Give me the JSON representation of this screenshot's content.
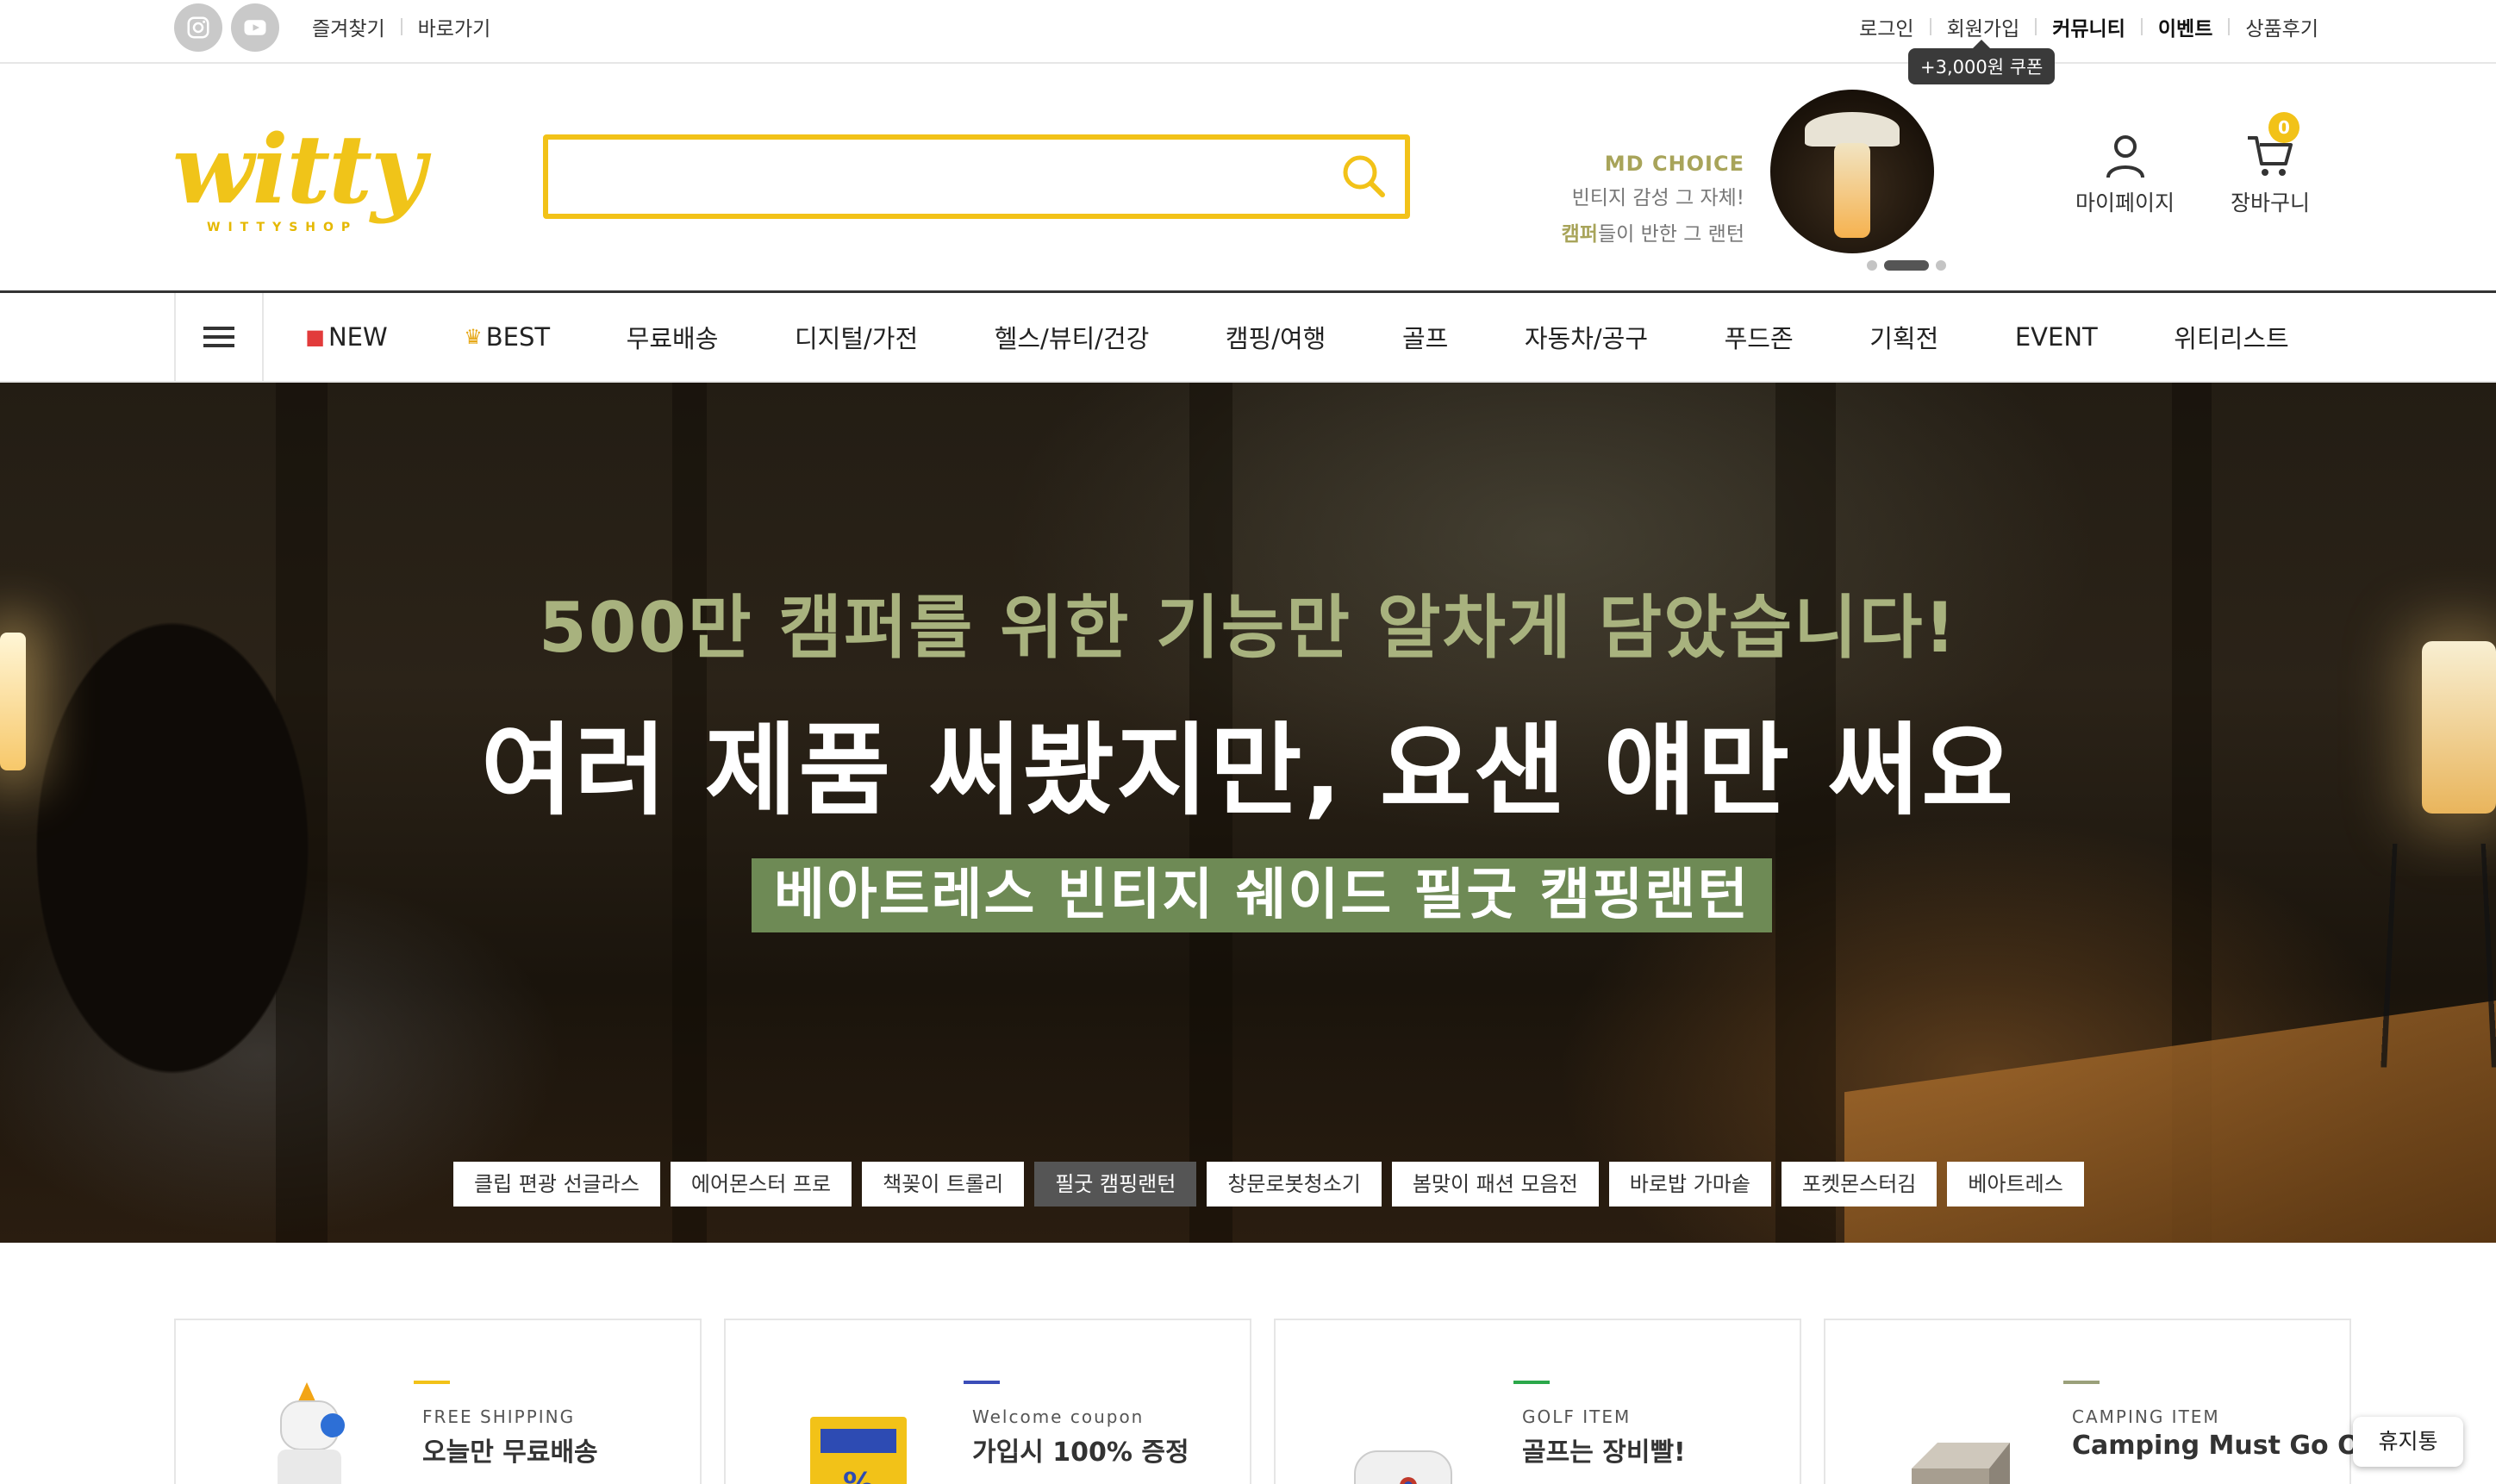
{
  "topbar": {
    "sns": [
      "instagram-icon",
      "youtube-icon"
    ],
    "left_links": [
      "즐겨찾기",
      "바로가기"
    ],
    "right_links": [
      {
        "label": "로그인",
        "bold": false
      },
      {
        "label": "회원가입",
        "bold": false
      },
      {
        "label": "커뮤니티",
        "bold": true
      },
      {
        "label": "이벤트",
        "bold": true
      },
      {
        "label": "상품후기",
        "bold": false
      }
    ],
    "coupon_tip": "+3,000원 쿠폰"
  },
  "header": {
    "logo_text": "witty",
    "logo_sub": "WITTYSHOP",
    "search_placeholder": "",
    "md_choice": {
      "title": "MD CHOICE",
      "line1": "빈티지 감성 그 자체!",
      "line2_highlight": "캠퍼",
      "line2_rest": "들이 반한 그 랜턴"
    },
    "mypage_label": "마이페이지",
    "cart_label": "장바구니",
    "cart_count": "0"
  },
  "nav": {
    "items": [
      {
        "icon": "gift-icon",
        "label": "NEW"
      },
      {
        "icon": "crown-icon",
        "label": "BEST"
      },
      {
        "label": "무료배송"
      },
      {
        "label": "디지털/가전"
      },
      {
        "label": "헬스/뷰티/건강"
      },
      {
        "label": "캠핑/여행"
      },
      {
        "label": "골프"
      },
      {
        "label": "자동차/공구"
      },
      {
        "label": "푸드존"
      },
      {
        "label": "기획전"
      },
      {
        "label": "EVENT"
      },
      {
        "label": "위티리스트"
      }
    ]
  },
  "hero": {
    "subtitle": "500만 캠퍼를 위한 기능만 알차게 담았습니다!",
    "title": "여러 제품 써봤지만, 요샌 얘만 써요",
    "tag": "베아트레스 빈티지 쉐이드 필굿 캠핑랜턴",
    "chips": [
      "클립 편광 선글라스",
      "에어몬스터 프로",
      "책꽂이 트롤리",
      "필굿 캠핑랜턴",
      "창문로봇청소기",
      "봄맞이 패션 모음전",
      "바로밥 가마솥",
      "포켓몬스터김",
      "베아트레스"
    ],
    "active_chip": 3
  },
  "cards": [
    {
      "label": "FREE SHIPPING",
      "heading": "오늘만 무료배송",
      "accent": "#f2c218",
      "image": "robot-icon"
    },
    {
      "label": "Welcome coupon",
      "heading": "가입시 100% 증정",
      "accent": "#3b4db8",
      "image": "coupon-icon"
    },
    {
      "label": "GOLF ITEM",
      "heading": "골프는 장비빨!",
      "accent": "#2ba84a",
      "image": "rangefinder-icon"
    },
    {
      "label": "CAMPING ITEM",
      "heading": "Camping Must Go On",
      "accent": "#9aa07a",
      "image": "grill-icon"
    }
  ],
  "floating": {
    "trash_label": "휴지통"
  },
  "colors": {
    "brand_yellow": "#f2c218",
    "hero_tag_green": "#6e8a55",
    "hero_sub": "#a8b27e"
  }
}
